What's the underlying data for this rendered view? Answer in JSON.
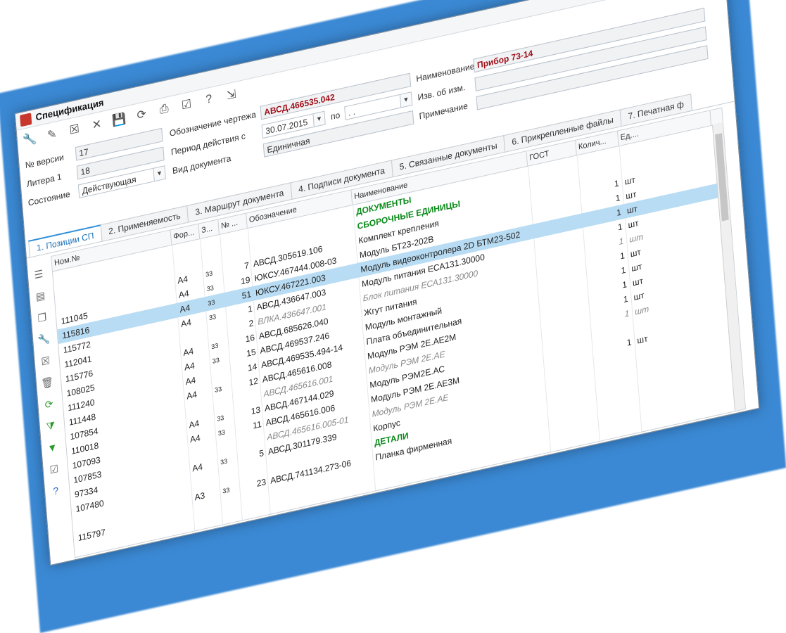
{
  "window": {
    "title": "Спецификация",
    "controls": [
      "—",
      "☐",
      "✕"
    ]
  },
  "toolbar": {
    "icons": [
      "tools-icon",
      "edit-icon",
      "cancel-icon",
      "delete-icon",
      "save-icon",
      "refresh-icon",
      "print-icon",
      "form-icon",
      "help-icon",
      "exit-icon"
    ]
  },
  "form": {
    "version_label": "№ версии",
    "version_value": "17",
    "litera_label": "Литера 1",
    "litera_value": "18",
    "state_label": "Состояние",
    "state_value": "Действующая",
    "drawing_label": "Обозначение чертежа",
    "drawing_value": "АВСД.466535.042",
    "period_label": "Период действия с",
    "period_from": "30.07.2015",
    "period_to_label": "по",
    "period_to": ". .",
    "doctype_label": "Вид документа",
    "doctype_value": "Единичная",
    "name_label": "Наименование",
    "name_value": "Прибор 73-14",
    "change_label": "Изв. об изм.",
    "change_value": "",
    "note_label": "Примечание",
    "note_value": ""
  },
  "tabs": [
    "1. Позиции СП",
    "2. Применяемость",
    "3. Маршрут документа",
    "4. Подписи документа",
    "5. Связанные документы",
    "6. Прикрепленные файлы",
    "7. Печатная ф"
  ],
  "grid": {
    "headers": [
      "Ном.№",
      "Фор...",
      "З...",
      "№ ...",
      "Обозначение",
      "Наименование",
      "ГОСТ",
      "Колич...",
      "Ед...."
    ],
    "rows": [
      {
        "nom": "",
        "fmt": "",
        "z": "",
        "num": "",
        "code": "",
        "name": "ДОКУМЕНТЫ",
        "qty": "",
        "unit": "",
        "style": "green"
      },
      {
        "nom": "",
        "fmt": "",
        "z": "",
        "num": "",
        "code": "",
        "name": "СБОРОЧНЫЕ ЕДИНИЦЫ",
        "qty": "",
        "unit": "",
        "style": "green"
      },
      {
        "nom": "",
        "fmt": "А4",
        "z": "33",
        "num": "7",
        "code": "АВСД.305619.106",
        "name": "Комплект крепления",
        "qty": "1",
        "unit": "шт",
        "style": ""
      },
      {
        "nom": "111045",
        "fmt": "А4",
        "z": "33",
        "num": "19",
        "code": "ЮКСУ.467444.008-03",
        "name": "Модуль БТ23-202В",
        "qty": "1",
        "unit": "шт",
        "style": ""
      },
      {
        "nom": "115816",
        "fmt": "А4",
        "z": "33",
        "num": "51",
        "code": "ЮКСУ.467221.003",
        "name": "Модуль видеоконтролера 2D БТМ23-502",
        "qty": "1",
        "unit": "шт",
        "style": "sel"
      },
      {
        "nom": "115772",
        "fmt": "А4",
        "z": "33",
        "num": "1",
        "code": "АВСД.436647.003",
        "name": "Модуль питания ЕСА131.30000",
        "qty": "1",
        "unit": "шт",
        "style": ""
      },
      {
        "nom": "112041",
        "fmt": "",
        "z": "",
        "num": "2",
        "code": "ВЛКА.436647.001",
        "name": "Блок питания ЕСА131.30000",
        "qty": "1",
        "unit": "шт",
        "style": "gray"
      },
      {
        "nom": "115776",
        "fmt": "А4",
        "z": "33",
        "num": "16",
        "code": "АВСД.685626.040",
        "name": "Жгут питания",
        "qty": "1",
        "unit": "шт",
        "style": ""
      },
      {
        "nom": "108025",
        "fmt": "А4",
        "z": "33",
        "num": "15",
        "code": "АВСД.469537.246",
        "name": "Модуль монтажный",
        "qty": "1",
        "unit": "шт",
        "style": ""
      },
      {
        "nom": "111240",
        "fmt": "А4",
        "z": "",
        "num": "14",
        "code": "АВСД.469535.494-14",
        "name": "Плата объединительная",
        "qty": "1",
        "unit": "шт",
        "style": ""
      },
      {
        "nom": "111448",
        "fmt": "А4",
        "z": "33",
        "num": "12",
        "code": "АВСД.465616.008",
        "name": "Модуль РЭМ 2Е.АЕ2М",
        "qty": "1",
        "unit": "шт",
        "style": ""
      },
      {
        "nom": "107854",
        "fmt": "",
        "z": "",
        "num": "",
        "code": "АВСД.465616.001",
        "name": "Модуль РЭМ 2Е.АЕ",
        "qty": "1",
        "unit": "шт",
        "style": "gray"
      },
      {
        "nom": "110018",
        "fmt": "А4",
        "z": "33",
        "num": "13",
        "code": "АВСД.467144.029",
        "name": "Модуль РЭМ2Е.АС",
        "qty": "",
        "unit": "",
        "style": ""
      },
      {
        "nom": "107093",
        "fmt": "А4",
        "z": "33",
        "num": "11",
        "code": "АВСД.465616.006",
        "name": "Модуль РЭМ 2Е.АЕ3М",
        "qty": "1",
        "unit": "шт",
        "style": ""
      },
      {
        "nom": "107853",
        "fmt": "",
        "z": "",
        "num": "",
        "code": "АВСД.465616.005-01",
        "name": "Модуль РЭМ 2Е.АЕ",
        "qty": "",
        "unit": "",
        "style": "gray"
      },
      {
        "nom": "97334",
        "fmt": "А4",
        "z": "33",
        "num": "5",
        "code": "АВСД.301179.339",
        "name": "Корпус",
        "qty": "",
        "unit": "",
        "style": ""
      },
      {
        "nom": "107480",
        "fmt": "",
        "z": "",
        "num": "",
        "code": "",
        "name": "ДЕТАЛИ",
        "qty": "",
        "unit": "",
        "style": "green"
      },
      {
        "nom": "",
        "fmt": "А3",
        "z": "33",
        "num": "23",
        "code": "АВСД.741134.273-06",
        "name": "Планка фирменная",
        "qty": "",
        "unit": "",
        "style": ""
      },
      {
        "nom": "115797",
        "fmt": "",
        "z": "",
        "num": "",
        "code": "",
        "name": "",
        "qty": "",
        "unit": "",
        "style": ""
      }
    ]
  },
  "sidebar": {
    "icons": [
      "list-icon",
      "doc-icon",
      "copy-icon",
      "tools-icon",
      "cancel-icon",
      "trash-icon",
      "refresh-icon",
      "filter-add-icon",
      "filter-icon",
      "edit-icon",
      "help-icon"
    ]
  }
}
